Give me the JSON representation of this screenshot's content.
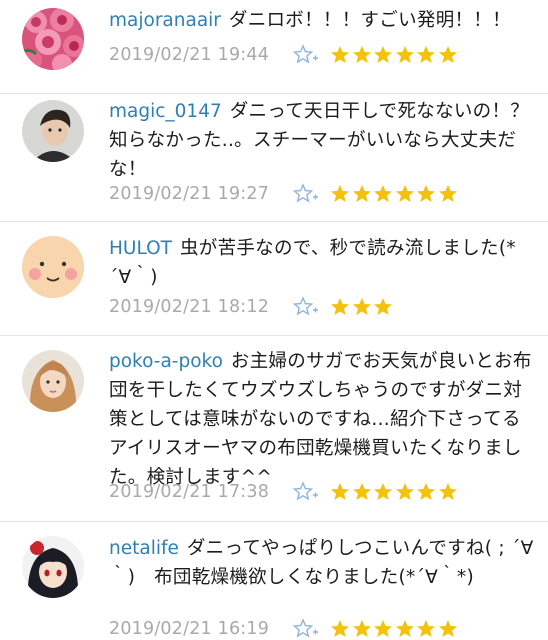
{
  "comments": [
    {
      "username": "majoranaair",
      "text": "ダニロボ！！！すごい発明！！！",
      "date": "2019/02/21 19:44",
      "rating": 6,
      "avatar": "rose-flowers-avatar"
    },
    {
      "username": "magic_0147",
      "text": "ダニって天日干しで死なないの！？知らなかった..。スチーマーがいいなら大丈夫だな！",
      "date": "2019/02/21 19:27",
      "rating": 6,
      "avatar": "man-portrait-avatar"
    },
    {
      "username": "HULOT",
      "text": "虫が苦手なので、秒で読み流しました(*´∀｀)",
      "date": "2019/02/21 18:12",
      "rating": 3,
      "avatar": "smiling-face-avatar"
    },
    {
      "username": "poko-a-poko",
      "text": "お主婦のサガでお天気が良いとお布団を干したくてウズウズしちゃうのですがダニ対策としては意味がないのですね…紹介下さってるアイリスオーヤマの布団乾燥機買いたくなりました。検討します^^",
      "date": "2019/02/21 17:38",
      "rating": 6,
      "avatar": "woman-portrait-avatar"
    },
    {
      "username": "netalife",
      "text": "ダニってやっぱりしつこいんですね( ; ´∀｀)　布団乾燥機欲しくなりました(*´∀｀*)",
      "date": "2019/02/21 16:19",
      "rating": 6,
      "avatar": "anime-girl-avatar"
    }
  ],
  "colors": {
    "username": "#2f7fb6",
    "date": "#a9a9a9",
    "star": "#f4c20d",
    "favorite_icon": "#8fb3e0"
  },
  "icons": {
    "favorite": "star-plus-icon",
    "rating": "star-icon"
  }
}
